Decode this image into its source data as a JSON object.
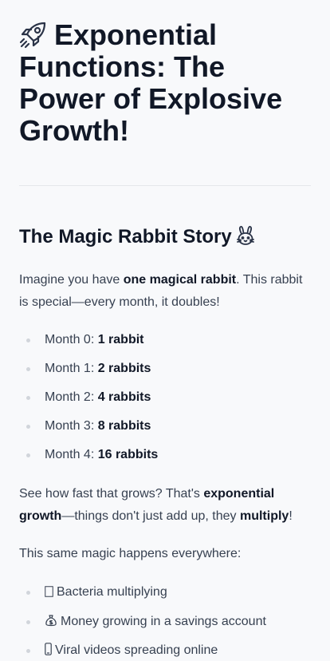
{
  "title": {
    "icon": "rocket-icon",
    "text": "Exponential Functions: The Power of Explosive Growth!"
  },
  "section": {
    "heading": "The Magic Rabbit Story",
    "icon": "rabbit-face-icon"
  },
  "intro": {
    "prefix": "Imagine you have ",
    "bold": "one magical rabbit",
    "suffix": ". This rabbit is special—every month, it doubles!"
  },
  "months": [
    {
      "label": "Month 0: ",
      "value": "1 rabbit"
    },
    {
      "label": "Month 1: ",
      "value": "2 rabbits"
    },
    {
      "label": "Month 2: ",
      "value": "4 rabbits"
    },
    {
      "label": "Month 3: ",
      "value": "8 rabbits"
    },
    {
      "label": "Month 4: ",
      "value": "16 rabbits"
    }
  ],
  "growth_note": {
    "prefix": "See how fast that grows? That's ",
    "bold1": "exponential growth",
    "middle": "—things don't just add up, they ",
    "bold2": "multiply",
    "suffix": "!"
  },
  "everywhere": "This same magic happens everywhere:",
  "examples": [
    {
      "icon": "microbe-icon",
      "text": "Bacteria multiplying"
    },
    {
      "icon": "money-bag-icon",
      "text": "Money growing in a savings account"
    },
    {
      "icon": "mobile-phone-icon",
      "text": "Viral videos spreading online"
    }
  ]
}
